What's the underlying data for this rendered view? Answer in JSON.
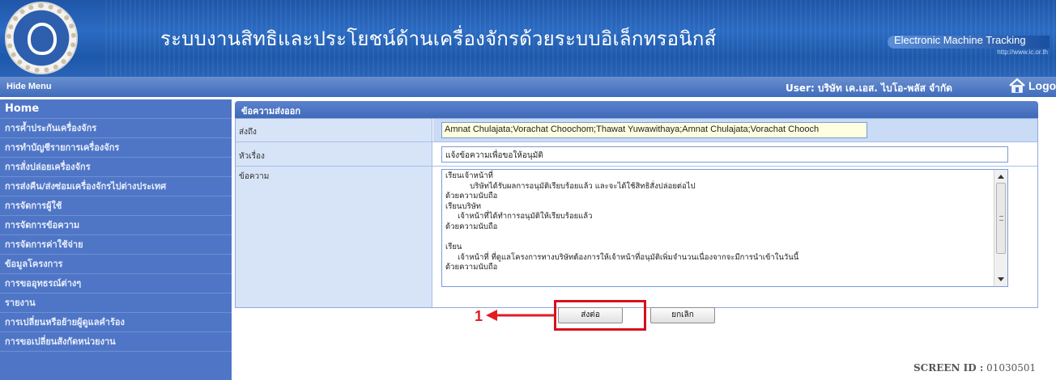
{
  "header": {
    "title": "ระบบงานสิทธิและประโยชน์ด้านเครื่องจักรด้วยระบบอิเล็กทรอนิกส์",
    "brand_name": "Electronic Machine Tracking",
    "brand_url": "http://www.ic.or.th"
  },
  "topbar": {
    "hide_menu": "Hide Menu",
    "user": "User: บริษัท เค.เอส. ไบโอ-พลัส จำกัด",
    "logout": "Logout"
  },
  "sidebar": {
    "items": [
      {
        "label": "Home"
      },
      {
        "label": "การค้ำประกันเครื่องจักร"
      },
      {
        "label": "การทำบัญชีรายการเครื่องจักร"
      },
      {
        "label": "การสั่งปล่อยเครื่องจักร"
      },
      {
        "label": "การส่งคืน/ส่งซ่อมเครื่องจักรไปต่างประเทศ"
      },
      {
        "label": "การจัดการผู้ใช้"
      },
      {
        "label": "การจัดการข้อความ"
      },
      {
        "label": "การจัดการค่าใช้จ่าย"
      },
      {
        "label": "ข้อมูลโครงการ"
      },
      {
        "label": "การขออุทธรณ์ต่างๆ"
      },
      {
        "label": "รายงาน"
      },
      {
        "label": "การเปลี่ยนหรือย้ายผู้ดูแลคำร้อง"
      },
      {
        "label": "การขอเปลี่ยนสังกัดหน่วยงาน"
      }
    ]
  },
  "panel": {
    "title": "ข้อความส่งออก",
    "to_label": "ส่งถึง",
    "to_value": "Amnat Chulajata;Vorachat Choochom;Thawat Yuwawithaya;Amnat Chulajata;Vorachat Chooch",
    "subject_label": "หัวเรื่อง",
    "subject_value": "แจ้งข้อความเพื่อขอให้อนุมัติ",
    "message_label": "ข้อความ",
    "message_value": "เรียนเจ้าหน้าที่\n          บริษัทได้รับผลการอนุมัติเรียบร้อยแล้ว และจะได้ใช้สิทธิสั่งปล่อยต่อไป\nด้วยความนับถือ\nเรียนบริษัท\n     เจ้าหน้าที่ได้ทำการอนุมัติให้เรียบร้อยแล้ว\nด้วยความนับถือ\n\nเรียน\n     เจ้าหน้าที่ ที่ดูแลโครงการทางบริษัทต้องการให้เจ้าหน้าที่อนุมัติเพิ่มจำนวนเนื่องจากจะมีการนำเข้าในวันนี้\nด้วยความนับถือ"
  },
  "buttons": {
    "send": "ส่งต่อ",
    "cancel": "ยกเลิก"
  },
  "annotation": {
    "number": "1",
    "color": "#e31b23"
  },
  "footer": {
    "screen_id_label": "SCREEN ID :",
    "screen_id_value": "01030501"
  }
}
